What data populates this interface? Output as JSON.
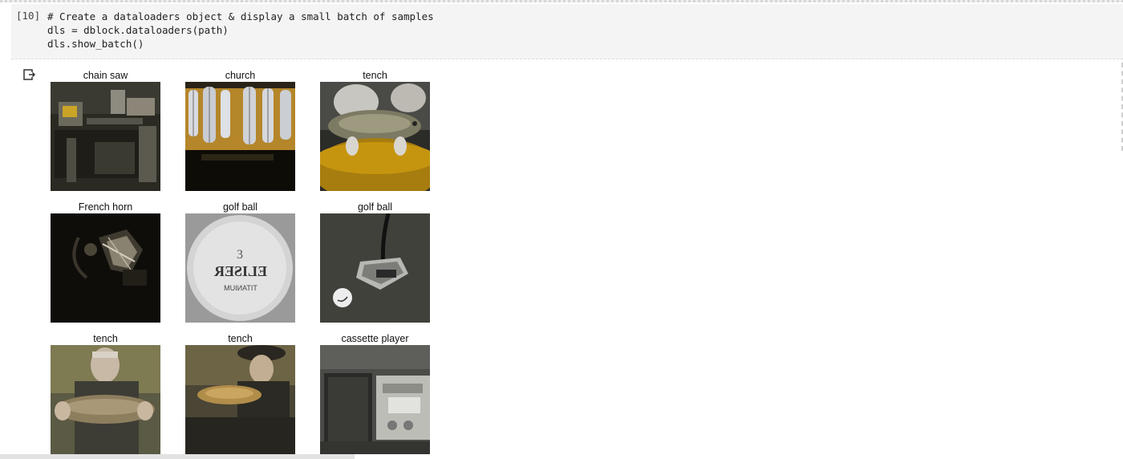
{
  "notebook": {
    "cell": {
      "exec_count": "[10]",
      "code_lines": [
        "# Create a dataloaders object & display a small batch of samples",
        "dls = dblock.dataloaders(path)",
        "dls.show_batch()"
      ]
    },
    "output": {
      "icon": "output-redirect-icon",
      "samples": [
        {
          "label": "chain saw",
          "thumbnail": "workshop-scene"
        },
        {
          "label": "church",
          "thumbnail": "stained-glass-windows"
        },
        {
          "label": "tench",
          "thumbnail": "fish-in-hand"
        },
        {
          "label": "French horn",
          "thumbnail": "dark-instrument"
        },
        {
          "label": "golf ball",
          "thumbnail": "golf-ball-closeup"
        },
        {
          "label": "golf ball",
          "thumbnail": "putter-and-ball"
        },
        {
          "label": "tench",
          "thumbnail": "man-holding-fish"
        },
        {
          "label": "tench",
          "thumbnail": "man-in-hat-with-fish"
        },
        {
          "label": "cassette player",
          "thumbnail": "boombox"
        }
      ],
      "ball_text": [
        "3",
        "ELISER",
        "TITANIUM"
      ]
    }
  }
}
